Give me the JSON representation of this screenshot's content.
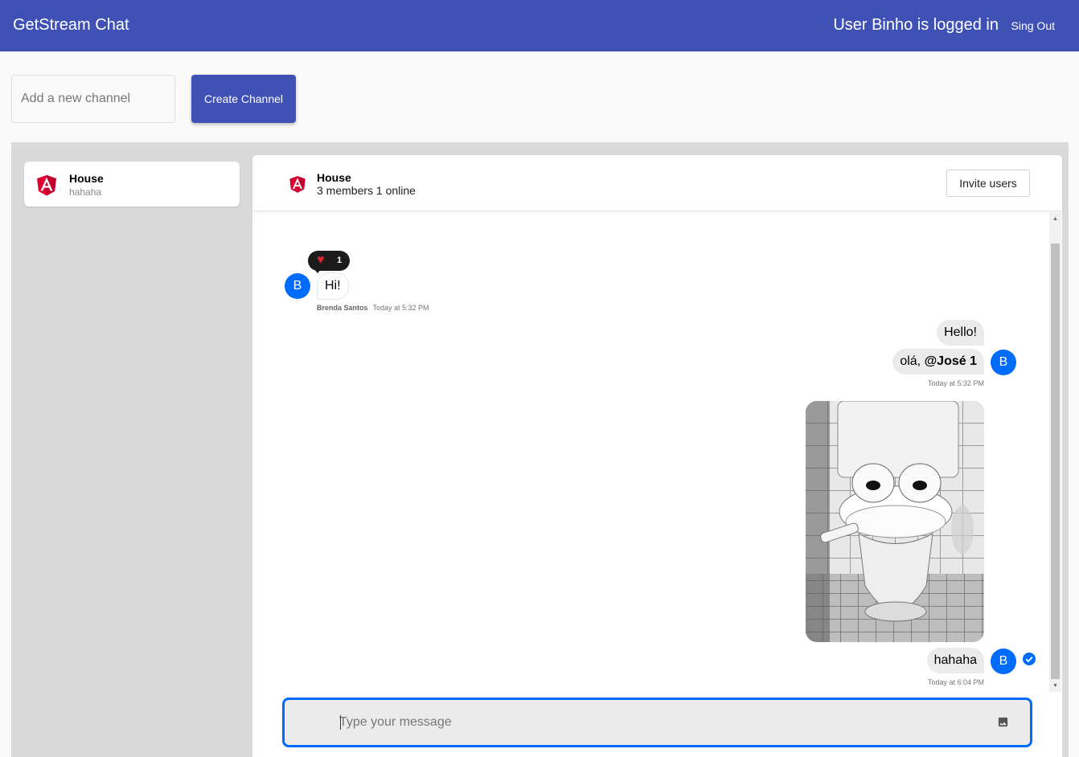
{
  "topbar": {
    "app_title": "GetStream Chat",
    "user_status": "User Binho is logged in",
    "signout_label": "Sing Out"
  },
  "new_channel": {
    "placeholder": "Add a new channel",
    "create_label": "Create Channel"
  },
  "channel_list": [
    {
      "name": "House",
      "preview": "hahaha",
      "icon": "angular-logo-icon"
    }
  ],
  "chat": {
    "channel_name": "House",
    "channel_status": "3 members 1 online",
    "invite_label": "Invite users",
    "messages": {
      "incoming": {
        "avatar": "B",
        "text": "Hi!",
        "reaction_icon": "heart-icon",
        "reaction_count": "1",
        "author": "Brenda Santos",
        "time": "Today at 5:32 PM"
      },
      "outgoing_group_1": {
        "avatar": "B",
        "line1": "Hello!",
        "line2_prefix": "olá, ",
        "line2_mention": "@José 1",
        "time": "Today at 5:32 PM"
      },
      "outgoing_group_2": {
        "avatar": "B",
        "image": "toilet-frog-photo",
        "text": "hahaha",
        "time": "Today at 6:04 PM",
        "status_icon": "read-check-icon"
      }
    },
    "composer": {
      "placeholder": "Type your message",
      "attach_icon": "image-icon"
    }
  },
  "colors": {
    "topbar": "#3f51b5",
    "accent": "#006cff",
    "workspace": "#dadada",
    "angular_red": "#dd0031"
  }
}
